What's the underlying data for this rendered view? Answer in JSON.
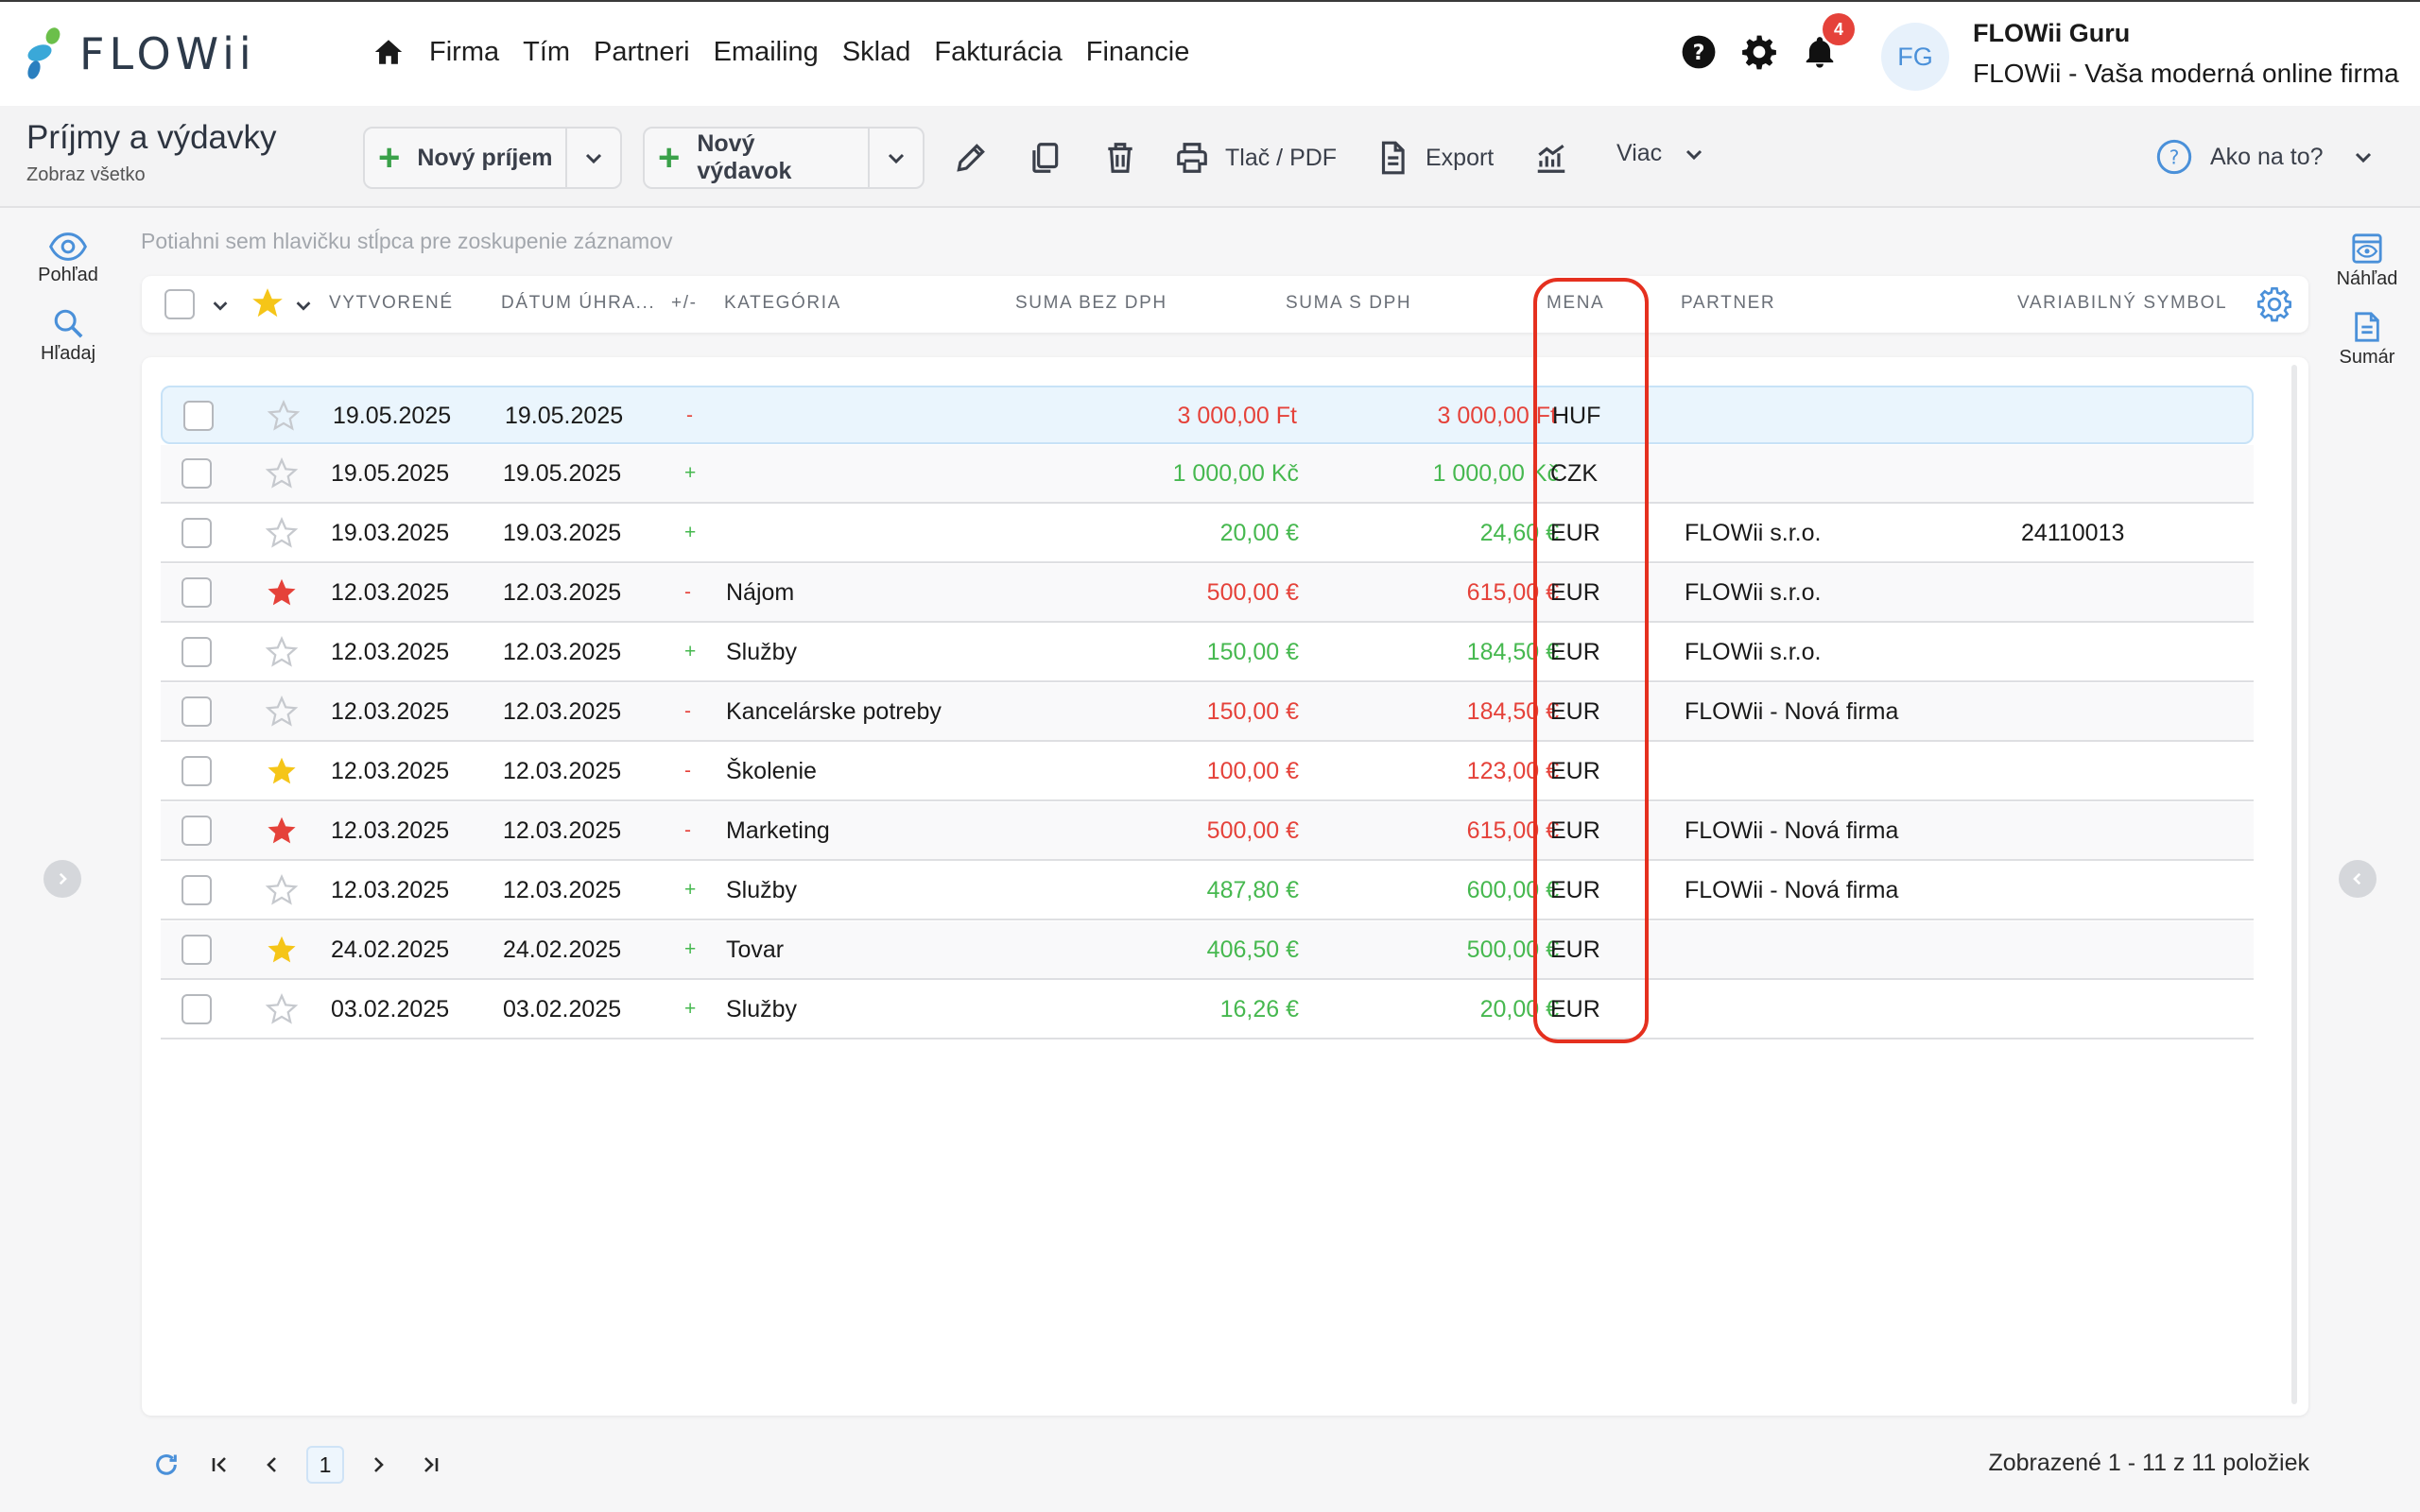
{
  "brand": {
    "name": "FLOWii"
  },
  "nav": {
    "items": [
      "Firma",
      "Tím",
      "Partneri",
      "Emailing",
      "Sklad",
      "Fakturácia",
      "Financie"
    ]
  },
  "notifications": {
    "count": "4"
  },
  "user": {
    "initials": "FG",
    "name": "FLOWii Guru",
    "company": "FLOWii - Vaša moderná online firma"
  },
  "page": {
    "title": "Príjmy a výdavky",
    "subtitle": "Zobraz všetko"
  },
  "toolbar": {
    "new_income": "Nový príjem",
    "new_expense": "Nový výdavok",
    "print": "Tlač / PDF",
    "export": "Export",
    "more": "Viac",
    "help": "Ako na to?"
  },
  "side_left": {
    "view": "Pohľad",
    "search": "Hľadaj"
  },
  "side_right": {
    "preview": "Náhľad",
    "summary": "Sumár"
  },
  "group_hint": "Potiahni sem hlavičku stĺpca pre zoskupenie záznamov",
  "columns": {
    "created": "VYTVORENÉ",
    "paid": "DÁTUM ÚHRA...",
    "sign": "+/-",
    "category": "KATEGÓRIA",
    "net": "SUMA BEZ DPH",
    "gross": "SUMA S DPH",
    "currency": "MENA",
    "partner": "PARTNER",
    "vs": "VARIABILNÝ SYMBOL"
  },
  "rows": [
    {
      "star": "empty",
      "created": "19.05.2025",
      "paid": "19.05.2025",
      "sign": "-",
      "category": "",
      "net": "3 000,00 Ft",
      "gross": "3 000,00 Ft",
      "currency": "HUF",
      "partner": "",
      "vs": ""
    },
    {
      "star": "empty",
      "created": "19.05.2025",
      "paid": "19.05.2025",
      "sign": "+",
      "category": "",
      "net": "1 000,00 Kč",
      "gross": "1 000,00 Kč",
      "currency": "CZK",
      "partner": "",
      "vs": ""
    },
    {
      "star": "empty",
      "created": "19.03.2025",
      "paid": "19.03.2025",
      "sign": "+",
      "category": "",
      "net": "20,00 €",
      "gross": "24,60 €",
      "currency": "EUR",
      "partner": "FLOWii s.r.o.",
      "vs": "24110013"
    },
    {
      "star": "red",
      "created": "12.03.2025",
      "paid": "12.03.2025",
      "sign": "-",
      "category": "Nájom",
      "net": "500,00 €",
      "gross": "615,00 €",
      "currency": "EUR",
      "partner": "FLOWii s.r.o.",
      "vs": ""
    },
    {
      "star": "empty",
      "created": "12.03.2025",
      "paid": "12.03.2025",
      "sign": "+",
      "category": "Služby",
      "net": "150,00 €",
      "gross": "184,50 €",
      "currency": "EUR",
      "partner": "FLOWii s.r.o.",
      "vs": ""
    },
    {
      "star": "empty",
      "created": "12.03.2025",
      "paid": "12.03.2025",
      "sign": "-",
      "category": "Kancelárske potreby",
      "net": "150,00 €",
      "gross": "184,50 €",
      "currency": "EUR",
      "partner": "FLOWii - Nová firma",
      "vs": ""
    },
    {
      "star": "yellow",
      "created": "12.03.2025",
      "paid": "12.03.2025",
      "sign": "-",
      "category": "Školenie",
      "net": "100,00 €",
      "gross": "123,00 €",
      "currency": "EUR",
      "partner": "",
      "vs": ""
    },
    {
      "star": "red",
      "created": "12.03.2025",
      "paid": "12.03.2025",
      "sign": "-",
      "category": "Marketing",
      "net": "500,00 €",
      "gross": "615,00 €",
      "currency": "EUR",
      "partner": "FLOWii - Nová firma",
      "vs": ""
    },
    {
      "star": "empty",
      "created": "12.03.2025",
      "paid": "12.03.2025",
      "sign": "+",
      "category": "Služby",
      "net": "487,80 €",
      "gross": "600,00 €",
      "currency": "EUR",
      "partner": "FLOWii - Nová firma",
      "vs": ""
    },
    {
      "star": "yellow",
      "created": "24.02.2025",
      "paid": "24.02.2025",
      "sign": "+",
      "category": "Tovar",
      "net": "406,50 €",
      "gross": "500,00 €",
      "currency": "EUR",
      "partner": "",
      "vs": ""
    },
    {
      "star": "empty",
      "created": "03.02.2025",
      "paid": "03.02.2025",
      "sign": "+",
      "category": "Služby",
      "net": "16,26 €",
      "gross": "20,00 €",
      "currency": "EUR",
      "partner": "",
      "vs": ""
    }
  ],
  "pager": {
    "current_page": "1",
    "info": "Zobrazené 1 - 11 z 11 položiek"
  },
  "colors": {
    "accent": "#4a90d9",
    "positive": "#46b84f",
    "negative": "#e5423a",
    "highlight": "#e5301f",
    "star_yellow": "#f5c518",
    "star_red": "#e5423a"
  }
}
